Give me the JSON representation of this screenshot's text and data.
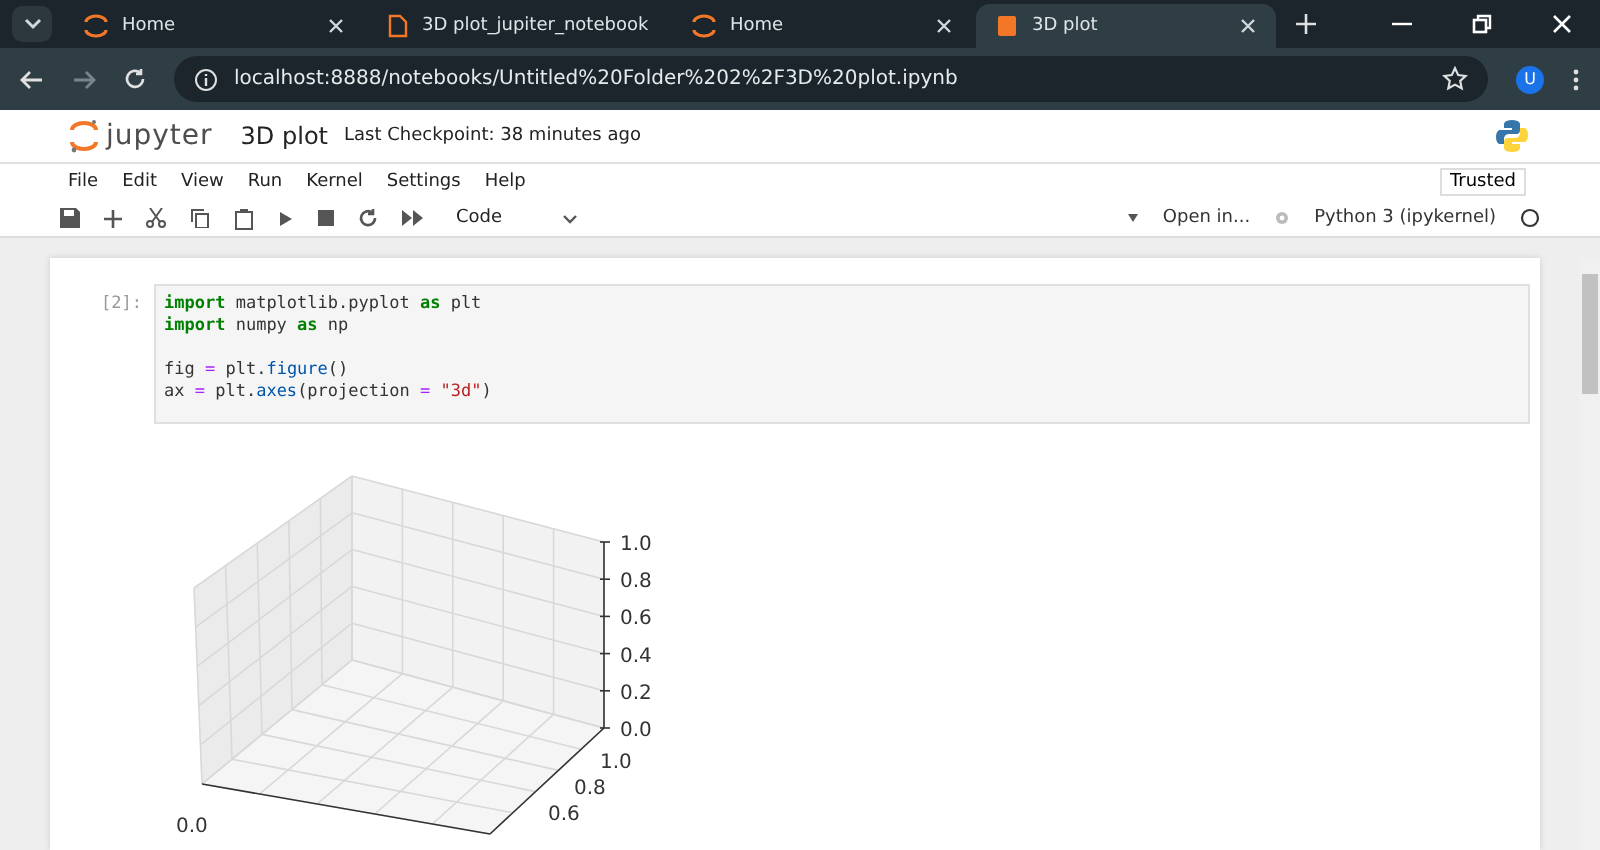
{
  "tabs": [
    {
      "label": "Home",
      "kind": "jupyter",
      "selected": false
    },
    {
      "label": "3D plot_jupiter_notebook",
      "kind": "file",
      "selected": false
    },
    {
      "label": "Home",
      "kind": "jupyter",
      "selected": false
    },
    {
      "label": "3D plot",
      "kind": "notebook",
      "selected": true
    }
  ],
  "address_bar": {
    "url": "localhost:8888/notebooks/Untitled%20Folder%202%2F3D%20plot.ipynb",
    "profile": "U"
  },
  "header": {
    "logo": "jupyter",
    "title": "3D plot",
    "checkpoint": "Last Checkpoint: 38 minutes ago"
  },
  "menu": [
    "File",
    "Edit",
    "View",
    "Run",
    "Kernel",
    "Settings",
    "Help"
  ],
  "trusted": "Trusted",
  "toolbar": {
    "cell_type": "Code",
    "open_in": "Open in...",
    "kernel": "Python 3 (ipykernel)"
  },
  "cell": {
    "prompt": "[2]:",
    "blocks": [
      [
        [
          {
            "kind": "keyword",
            "text": "import"
          },
          {
            "kind": "plain",
            "text": " matplotlib.pyplot "
          },
          {
            "kind": "keyword",
            "text": "as"
          },
          {
            "kind": "plain",
            "text": " plt"
          }
        ],
        [
          {
            "kind": "keyword",
            "text": "import"
          },
          {
            "kind": "plain",
            "text": " numpy "
          },
          {
            "kind": "keyword",
            "text": "as"
          },
          {
            "kind": "plain",
            "text": " np"
          }
        ]
      ],
      [
        [
          {
            "kind": "plain",
            "text": "fig "
          },
          {
            "kind": "operator",
            "text": "="
          },
          {
            "kind": "plain",
            "text": " plt."
          },
          {
            "kind": "function",
            "text": "figure"
          },
          {
            "kind": "plain",
            "text": "()"
          }
        ],
        [
          {
            "kind": "plain",
            "text": "ax "
          },
          {
            "kind": "operator",
            "text": "="
          },
          {
            "kind": "plain",
            "text": " plt."
          },
          {
            "kind": "function",
            "text": "axes"
          },
          {
            "kind": "plain",
            "text": "(projection "
          },
          {
            "kind": "operator",
            "text": "= "
          },
          {
            "kind": "string",
            "text": "\"3d\""
          },
          {
            "kind": "plain",
            "text": ")"
          }
        ]
      ]
    ]
  },
  "plot": {
    "z_ticks": [
      "1.0",
      "0.8",
      "0.6",
      "0.4",
      "0.2",
      "0.0"
    ],
    "y_ticks": [
      "1.0",
      "0.8",
      "0.6"
    ],
    "x_ticks": [
      "0.0"
    ]
  }
}
